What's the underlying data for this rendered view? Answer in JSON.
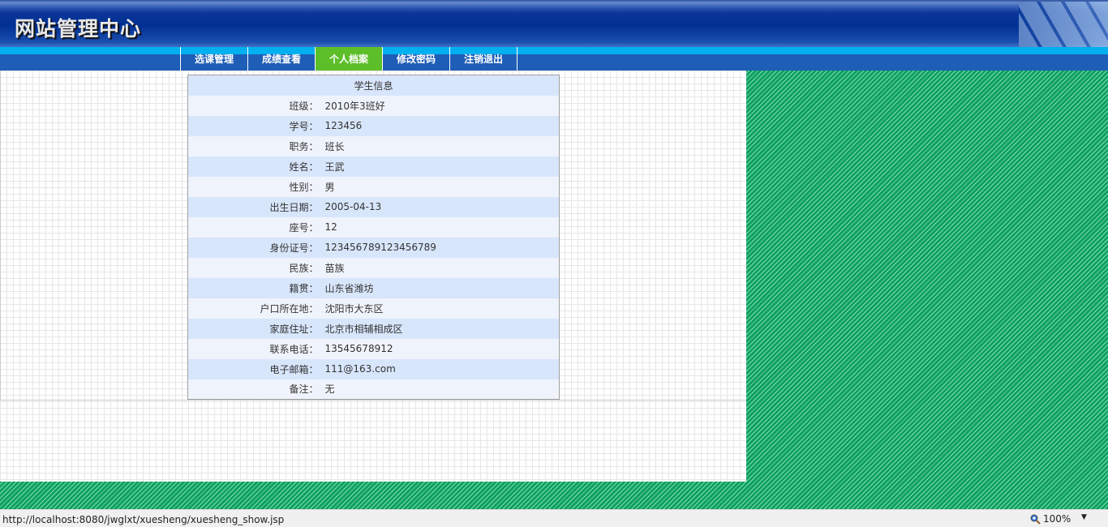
{
  "header": {
    "title": "网站管理中心"
  },
  "nav": [
    {
      "label": "选课管理"
    },
    {
      "label": "成绩查看"
    },
    {
      "label": "个人档案",
      "active": true
    },
    {
      "label": "修改密码"
    },
    {
      "label": "注销退出"
    }
  ],
  "table": {
    "title": "学生信息",
    "rows": [
      {
        "label": "班级：",
        "value": "2010年3班好"
      },
      {
        "label": "学号：",
        "value": "123456"
      },
      {
        "label": "职务：",
        "value": "班长"
      },
      {
        "label": "姓名：",
        "value": "王武"
      },
      {
        "label": "性别：",
        "value": "男"
      },
      {
        "label": "出生日期：",
        "value": "2005-04-13"
      },
      {
        "label": "座号：",
        "value": "12"
      },
      {
        "label": "身份证号：",
        "value": "123456789123456789"
      },
      {
        "label": "民族：",
        "value": "苗族"
      },
      {
        "label": "籍贯：",
        "value": "山东省潍坊"
      },
      {
        "label": "户口所在地：",
        "value": "沈阳市大东区"
      },
      {
        "label": "家庭住址：",
        "value": "北京市相辅相成区"
      },
      {
        "label": "联系电话：",
        "value": "13545678912"
      },
      {
        "label": "电子邮箱：",
        "value": "111@163.com"
      },
      {
        "label": "备注：",
        "value": "无"
      }
    ]
  },
  "status": {
    "url": "http://localhost:8080/jwglxt/xuesheng/xuesheng_show.jsp",
    "zoom": "100%"
  },
  "colors": {
    "active_tab": "#5cbf2a",
    "nav": "#1e5eb6",
    "header": "#003093"
  }
}
